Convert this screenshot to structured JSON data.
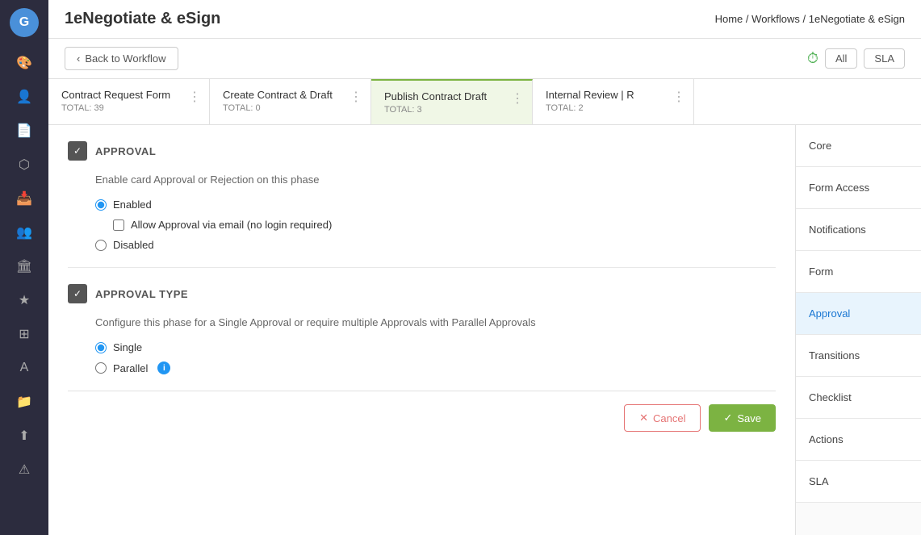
{
  "app": {
    "logo": "G",
    "title": "1eNegotiate & eSign"
  },
  "breadcrumb": {
    "home": "Home",
    "workflows": "Workflows",
    "current": "1eNegotiate & eSign"
  },
  "toolbar": {
    "back_label": "Back to Workflow",
    "all_label": "All",
    "sla_label": "SLA"
  },
  "workflow_tabs": [
    {
      "id": "tab1",
      "title": "Contract Request Form",
      "total": "TOTAL: 39",
      "active": false
    },
    {
      "id": "tab2",
      "title": "Create Contract & Draft",
      "total": "TOTAL: 0",
      "active": false
    },
    {
      "id": "tab3",
      "title": "Publish Contract Draft",
      "total": "TOTAL: 3",
      "active": true
    },
    {
      "id": "tab4",
      "title": "Internal Review | R",
      "total": "TOTAL: 2",
      "active": false
    }
  ],
  "approval_section": {
    "icon": "✓",
    "title": "APPROVAL",
    "description": "Enable card Approval or Rejection on this phase",
    "options": [
      {
        "id": "enabled",
        "label": "Enabled",
        "checked": true
      },
      {
        "id": "disabled",
        "label": "Disabled",
        "checked": false
      }
    ],
    "checkbox": {
      "id": "email_approval",
      "label": "Allow Approval via email (no login required)",
      "checked": false
    }
  },
  "approval_type_section": {
    "icon": "✓",
    "title": "APPROVAL TYPE",
    "description": "Configure this phase for a Single Approval or require multiple Approvals with Parallel Approvals",
    "options": [
      {
        "id": "single",
        "label": "Single",
        "checked": true
      },
      {
        "id": "parallel",
        "label": "Parallel",
        "checked": false
      }
    ],
    "parallel_info": "i"
  },
  "action_bar": {
    "cancel_label": "Cancel",
    "save_label": "Save"
  },
  "right_panel": {
    "items": [
      {
        "id": "core",
        "label": "Core",
        "active": false
      },
      {
        "id": "form_access",
        "label": "Form Access",
        "active": false
      },
      {
        "id": "notifications",
        "label": "Notifications",
        "active": false
      },
      {
        "id": "form",
        "label": "Form",
        "active": false
      },
      {
        "id": "approval",
        "label": "Approval",
        "active": true
      },
      {
        "id": "transitions",
        "label": "Transitions",
        "active": false
      },
      {
        "id": "checklist",
        "label": "Checklist",
        "active": false
      },
      {
        "id": "actions",
        "label": "Actions",
        "active": false
      },
      {
        "id": "sla",
        "label": "SLA",
        "active": false
      }
    ]
  },
  "sidebar": {
    "icons": [
      {
        "id": "dashboard",
        "symbol": "🎨",
        "active": false
      },
      {
        "id": "users",
        "symbol": "👤",
        "active": false
      },
      {
        "id": "documents",
        "symbol": "📄",
        "active": false
      },
      {
        "id": "layers",
        "symbol": "⬡",
        "active": false
      },
      {
        "id": "inbox",
        "symbol": "📥",
        "active": false
      },
      {
        "id": "team",
        "symbol": "👥",
        "active": false
      },
      {
        "id": "bank",
        "symbol": "🏛",
        "active": false
      },
      {
        "id": "star",
        "symbol": "★",
        "active": false
      },
      {
        "id": "grid",
        "symbol": "⊞",
        "active": false
      },
      {
        "id": "text",
        "symbol": "A",
        "active": false
      },
      {
        "id": "folder",
        "symbol": "📁",
        "active": false
      },
      {
        "id": "upload",
        "symbol": "⬆",
        "active": false
      },
      {
        "id": "warning",
        "symbol": "⚠",
        "active": false
      }
    ]
  }
}
